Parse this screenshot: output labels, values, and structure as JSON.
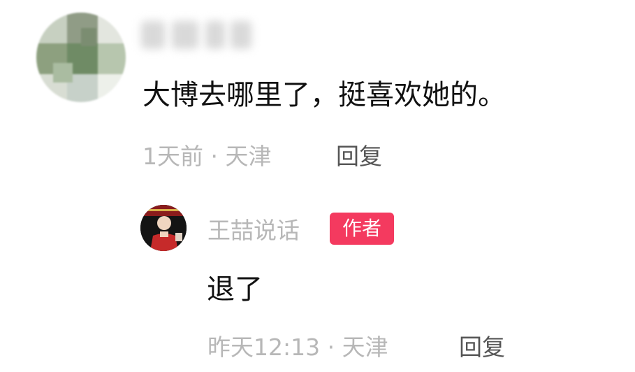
{
  "comment": {
    "text": "大博去哪里了，挺喜欢她的。",
    "time": "1天前",
    "separator": "·",
    "location": "天津",
    "reply_label": "回复"
  },
  "reply": {
    "author": "王喆说话",
    "badge": "作者",
    "text": "退了",
    "time": "昨天12:13",
    "separator": "·",
    "location": "天津",
    "reply_label": "回复"
  },
  "colors": {
    "badge_bg": "#f43a5f",
    "meta_text": "#b7b7b7",
    "body_text": "#111111",
    "reply_button": "#555555"
  }
}
